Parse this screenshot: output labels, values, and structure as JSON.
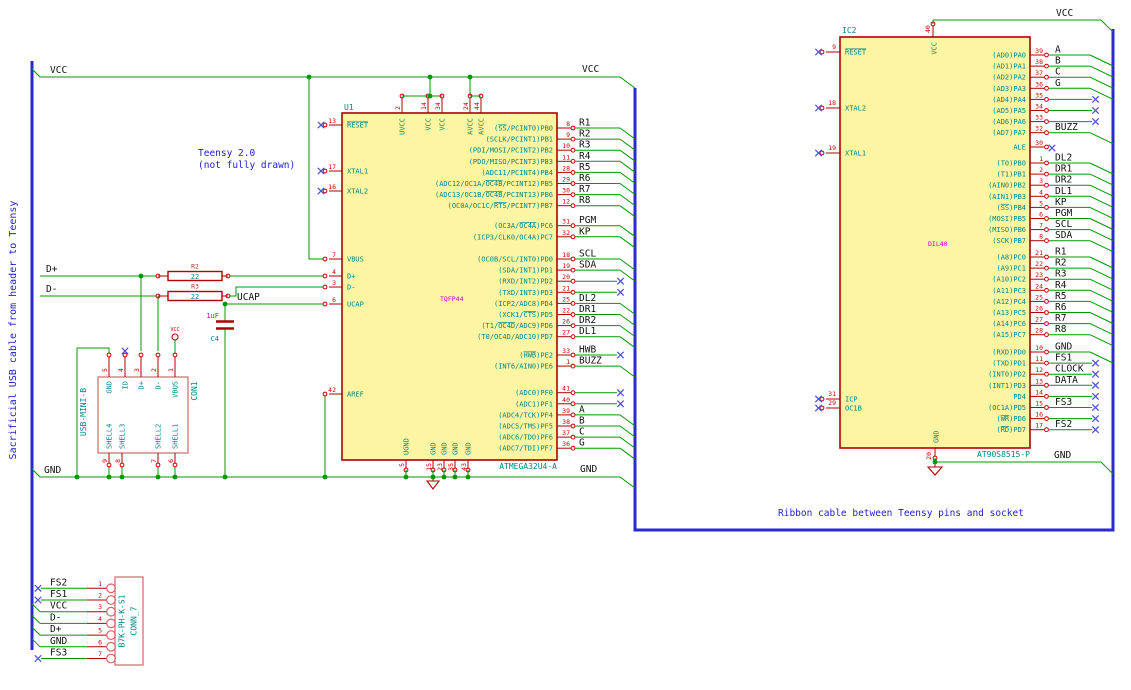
{
  "notes": {
    "teensy_line1": "Teensy 2.0",
    "teensy_line2": "(not fully drawn)",
    "ribbon": "Ribbon cable between Teensy pins and socket",
    "sacrificial": "Sacrificial USB cable from header to Teensy"
  },
  "power": {
    "vcc": "VCC",
    "gnd": "GND"
  },
  "misc": {
    "ucap": "UCAP",
    "d_plus": "D+",
    "d_minus": "D-"
  },
  "colors": {
    "wire_green": "#009800",
    "bus_blue": "#2a2ad0",
    "symbol_red": "#b00000",
    "ic_fill_yellow": "#fdf5a1",
    "pin_name_teal": "#008888",
    "note_blue": "#2222cc",
    "field_magenta": "#c400c4",
    "label_black": "#101010"
  },
  "u1": {
    "ref": "U1",
    "value": "ATMEGA32U4-A",
    "footprint": "TQFP44",
    "left_pins": [
      {
        "num": "13",
        "name": "~RESET~",
        "nc": true
      },
      {
        "num": "17",
        "name": "XTAL1",
        "nc": true
      },
      {
        "num": "16",
        "name": "XTAL2",
        "nc": true
      },
      {
        "num": "7",
        "name": "VBUS"
      },
      {
        "num": "4",
        "name": "D+"
      },
      {
        "num": "3",
        "name": "D-"
      },
      {
        "num": "6",
        "name": "UCAP"
      },
      {
        "num": "42",
        "name": "AREF"
      }
    ],
    "top_pins": [
      {
        "num": "2",
        "name": "UVCC"
      },
      {
        "num": "14",
        "name": "VCC"
      },
      {
        "num": "34",
        "name": "VCC"
      },
      {
        "num": "24",
        "name": "AVCC"
      },
      {
        "num": "44",
        "name": "AVCC"
      }
    ],
    "bottom_pins": [
      {
        "num": "5",
        "name": "UGND"
      },
      {
        "num": "15",
        "name": "GND"
      },
      {
        "num": "23",
        "name": "GND"
      },
      {
        "num": "35",
        "name": "GND"
      },
      {
        "num": "43",
        "name": "GND"
      }
    ],
    "right_groups": [
      {
        "pins": [
          {
            "num": "8",
            "name": "(~SS~/PCINT0)PB0",
            "net": "R1",
            "dst": "bus"
          },
          {
            "num": "9",
            "name": "(SCLK/PCINT1)PB1",
            "net": "R2",
            "dst": "bus"
          },
          {
            "num": "10",
            "name": "(PDI/MOSI/PCINT2)PB2",
            "net": "R3",
            "dst": "bus"
          },
          {
            "num": "11",
            "name": "(PDO/MISO/PCINT3)PB3",
            "net": "R4",
            "dst": "bus"
          },
          {
            "num": "28",
            "name": "(ADC11/PCINT4)PB4",
            "net": "R5",
            "dst": "bus"
          },
          {
            "num": "29",
            "name": "(ADC12/OC1A/~OC4B~/PCINT12)PB5",
            "net": "R6",
            "dst": "bus"
          },
          {
            "num": "30",
            "name": "(ADC13/OC1B/~OC4B~/PCINT13)PB6",
            "net": "R7",
            "dst": "bus"
          },
          {
            "num": "12",
            "name": "(OC0A/OC1C/~RTS~/PCINT7)PB7",
            "net": "R8",
            "dst": "bus"
          }
        ]
      },
      {
        "pins": [
          {
            "num": "31",
            "name": "(OC3A/~OC4A~)PC6",
            "net": "PGM",
            "dst": "bus"
          },
          {
            "num": "32",
            "name": "(ICP3/CLK0/OC4A)PC7",
            "net": "KP",
            "dst": "bus"
          }
        ]
      },
      {
        "pins": [
          {
            "num": "18",
            "name": "(OC0B/SCL/INT0)PD0",
            "net": "SCL",
            "dst": "bus"
          },
          {
            "num": "19",
            "name": "(SDA/INT1)PD1",
            "net": "SDA",
            "dst": "bus"
          },
          {
            "num": "20",
            "name": "(RXD/INT2)PD2",
            "dst": "nc"
          },
          {
            "num": "21",
            "name": "(TXD/INT3)PD3",
            "dst": "nc"
          },
          {
            "num": "25",
            "name": "(ICP2/ADC8)PD4",
            "net": "DL2",
            "dst": "bus"
          },
          {
            "num": "22",
            "name": "(XCK1/~CTS~)PD5",
            "net": "DR1",
            "dst": "bus"
          },
          {
            "num": "26",
            "name": "(T1/~OC4D~/ADC9)PD6",
            "net": "DR2",
            "dst": "bus"
          },
          {
            "num": "27",
            "name": "(T0/OC4D/ADC10)PD7",
            "net": "DL1",
            "dst": "bus"
          }
        ]
      },
      {
        "pins": [
          {
            "num": "33",
            "name": "(~HWB~)PE2",
            "net": "HWB",
            "dst": "nc"
          },
          {
            "num": "1",
            "name": "(INT6/AIN0)PE6",
            "net": "BUZZ",
            "dst": "bus"
          }
        ]
      },
      {
        "pins": [
          {
            "num": "41",
            "name": "(ADC0)PF0",
            "dst": "nc"
          },
          {
            "num": "40",
            "name": "(ADC1)PF1",
            "dst": "nc"
          },
          {
            "num": "39",
            "name": "(ADC4/TCK)PF4",
            "net": "A",
            "dst": "bus"
          },
          {
            "num": "38",
            "name": "(ADC5/TMS)PF5",
            "net": "B",
            "dst": "bus"
          },
          {
            "num": "37",
            "name": "(ADC6/TDO)PF6",
            "net": "C",
            "dst": "bus"
          },
          {
            "num": "36",
            "name": "(ADC7/TDI)PF7",
            "net": "G",
            "dst": "bus"
          }
        ]
      }
    ]
  },
  "ic2": {
    "ref": "IC2",
    "value": "AT90S8515-P",
    "footprint": "DIL40",
    "left_pins": [
      {
        "num": "9",
        "name": "~RESET~",
        "nc": true
      },
      {
        "num": "18",
        "name": "XTAL2",
        "nc": true
      },
      {
        "num": "19",
        "name": "XTAL1",
        "nc": true
      },
      {
        "num": "31",
        "name": "ICP",
        "nc": true
      },
      {
        "num": "29",
        "name": "OC1B",
        "nc": true
      }
    ],
    "top_pin": {
      "num": "40",
      "name": "VCC"
    },
    "bottom_pin": {
      "num": "20",
      "name": "GND"
    },
    "right_groups": [
      {
        "pins": [
          {
            "num": "39",
            "name": "(AD0)PA0",
            "net": "A",
            "dst": "bus"
          },
          {
            "num": "38",
            "name": "(AD1)PA1",
            "net": "B",
            "dst": "bus"
          },
          {
            "num": "37",
            "name": "(AD2)PA2",
            "net": "C",
            "dst": "bus"
          },
          {
            "num": "36",
            "name": "(AD3)PA3",
            "net": "G",
            "dst": "bus"
          },
          {
            "num": "35",
            "name": "(AD4)PA4",
            "dst": "nc"
          },
          {
            "num": "34",
            "name": "(AD5)PA5",
            "dst": "nc"
          },
          {
            "num": "33",
            "name": "(AD6)PA6",
            "dst": "nc"
          },
          {
            "num": "32",
            "name": "(AD7)PA7",
            "net": "BUZZ",
            "dst": "bus"
          }
        ]
      },
      {
        "pins": [
          {
            "num": "30",
            "name": "ALE",
            "dst": "ncpin"
          }
        ]
      },
      {
        "pins": [
          {
            "num": "1",
            "name": "(T0)PB0",
            "net": "DL2",
            "dst": "bus"
          },
          {
            "num": "2",
            "name": "(T1)PB1",
            "net": "DR1",
            "dst": "bus"
          },
          {
            "num": "3",
            "name": "(AIN0)PB2",
            "net": "DR2",
            "dst": "bus"
          },
          {
            "num": "4",
            "name": "(AIN1)PB3",
            "net": "DL1",
            "dst": "bus"
          },
          {
            "num": "5",
            "name": "(~SS~)PB4",
            "net": "KP",
            "dst": "bus"
          },
          {
            "num": "6",
            "name": "(MOSI)PB5",
            "net": "PGM",
            "dst": "bus"
          },
          {
            "num": "7",
            "name": "(MISO)PB6",
            "net": "SCL",
            "dst": "bus"
          },
          {
            "num": "8",
            "name": "(SCK)PB7",
            "net": "SDA",
            "dst": "bus"
          }
        ]
      },
      {
        "pins": [
          {
            "num": "21",
            "name": "(A8)PC0",
            "net": "R1",
            "dst": "bus"
          },
          {
            "num": "22",
            "name": "(A9)PC1",
            "net": "R2",
            "dst": "bus"
          },
          {
            "num": "23",
            "name": "(A10)PC2",
            "net": "R3",
            "dst": "bus"
          },
          {
            "num": "24",
            "name": "(A11)PC3",
            "net": "R4",
            "dst": "bus"
          },
          {
            "num": "25",
            "name": "(A12)PC4",
            "net": "R5",
            "dst": "bus"
          },
          {
            "num": "26",
            "name": "(A13)PC5",
            "net": "R6",
            "dst": "bus"
          },
          {
            "num": "27",
            "name": "(A14)PC6",
            "net": "R7",
            "dst": "bus"
          },
          {
            "num": "28",
            "name": "(A15)PC7",
            "net": "R8",
            "dst": "bus"
          }
        ]
      },
      {
        "pins": [
          {
            "num": "10",
            "name": "(RXD)PD0",
            "net": "GND",
            "dst": "bus"
          },
          {
            "num": "11",
            "name": "(TXD)PD1",
            "net": "FS1",
            "dst": "nc"
          },
          {
            "num": "12",
            "name": "(INT0)PD2",
            "net": "CLOCK",
            "dst": "nc"
          },
          {
            "num": "13",
            "name": "(INT1)PD3",
            "net": "DATA",
            "dst": "nc"
          },
          {
            "num": "14",
            "name": "PD4",
            "dst": "nc"
          },
          {
            "num": "15",
            "name": "(OC1A)PD5",
            "net": "FS3",
            "dst": "nc"
          },
          {
            "num": "16",
            "name": "(~WR~)PD6",
            "dst": "nc"
          },
          {
            "num": "17",
            "name": "(~RD~)PD7",
            "net": "FS2",
            "dst": "nc"
          }
        ]
      }
    ]
  },
  "con1": {
    "ref": "CON1",
    "value": "USB-MINI-B",
    "top_pins": [
      {
        "num": "5",
        "name": "GND"
      },
      {
        "num": "4",
        "name": "ID"
      },
      {
        "num": "3",
        "name": "D+"
      },
      {
        "num": "2",
        "name": "D-"
      },
      {
        "num": "1",
        "name": "VBUS"
      }
    ],
    "bottom_pins": [
      {
        "num": "9",
        "name": "SHELL4"
      },
      {
        "num": "8",
        "name": "SHELL3"
      },
      {
        "num": "7",
        "name": "SHELL2"
      },
      {
        "num": "6",
        "name": "SHELL1"
      }
    ]
  },
  "conn7": {
    "ref": "CONN_7",
    "value": "B7K-PH-K-S1",
    "pins": [
      {
        "num": "1",
        "net": "FS2",
        "nc": true
      },
      {
        "num": "2",
        "net": "FS1",
        "nc": true
      },
      {
        "num": "3",
        "net": "VCC"
      },
      {
        "num": "4",
        "net": "D-"
      },
      {
        "num": "5",
        "net": "D+"
      },
      {
        "num": "6",
        "net": "GND"
      },
      {
        "num": "7",
        "net": "FS3",
        "nc": true
      }
    ]
  },
  "r2": {
    "ref": "R2",
    "value": "22"
  },
  "r3": {
    "ref": "R3",
    "value": "22"
  },
  "c4": {
    "ref": "C4",
    "value": "1uF"
  }
}
